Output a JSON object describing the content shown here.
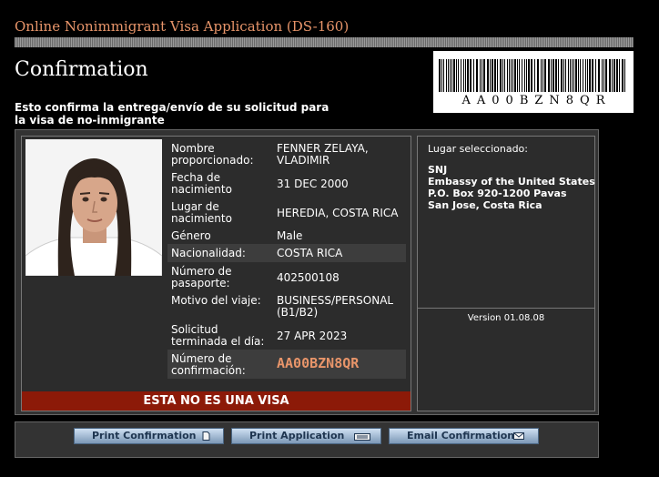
{
  "header": {
    "app_title": "Online Nonimmigrant Visa Application (DS-160)",
    "page_title": "Confirmation",
    "barcode_text": "AA00BZN8QR"
  },
  "intro": {
    "text": "Esto confirma la entrega/envío de su solicitud para la visa de no-inmigrante"
  },
  "applicant": {
    "fields": [
      {
        "label": "Nombre proporcionado:",
        "value": "FENNER ZELAYA, VLADIMIR"
      },
      {
        "label": "Fecha de nacimiento",
        "value": "31 DEC 2000"
      },
      {
        "label": "Lugar de nacimiento",
        "value": "HEREDIA, COSTA RICA"
      },
      {
        "label": "Género",
        "value": "Male"
      },
      {
        "label": "Nacionalidad:",
        "value": "COSTA RICA"
      },
      {
        "label": "Número de pasaporte:",
        "value": "402500108"
      },
      {
        "label": "Motivo del viaje:",
        "value": "BUSINESS/PERSONAL (B1/B2)"
      },
      {
        "label": "Solicitud terminada el día:",
        "value": "27 APR 2023"
      },
      {
        "label": "Número de confirmación:",
        "value": "AA00BZN8QR"
      }
    ],
    "banner": "ESTA NO ES UNA VISA"
  },
  "location": {
    "label": "Lugar seleccionado:",
    "lines": [
      "SNJ",
      "Embassy of the United States",
      "P.O. Box 920-1200 Pavas",
      "San Jose, Costa Rica"
    ],
    "version": "Version 01.08.08"
  },
  "buttons": {
    "print_confirmation": "Print Confirmation",
    "print_application": "Print Application",
    "email_confirmation": "Email Confirmation"
  },
  "colors": {
    "accent": "#e8956a",
    "banner": "#8c1a08",
    "panel": "#333333"
  }
}
